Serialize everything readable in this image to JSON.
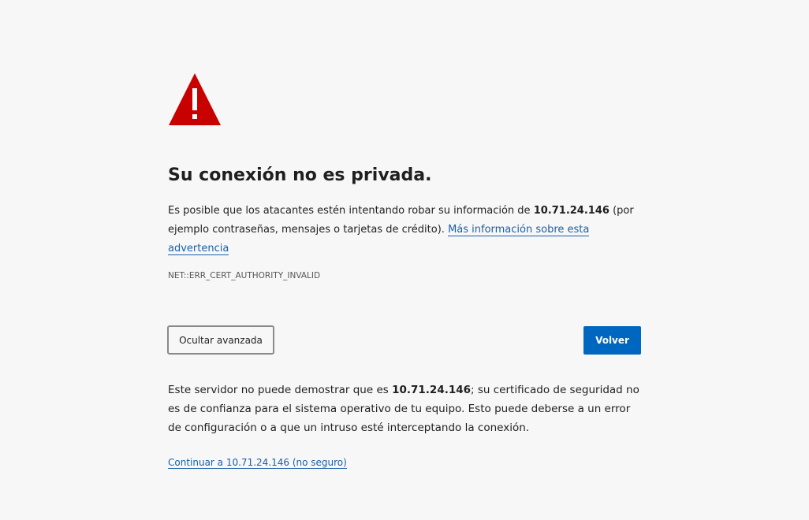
{
  "title": "Su conexión no es privada.",
  "intro": {
    "before_host": "Es posible que los atacantes estén intentando robar su información de ",
    "host": "10.71.24.146",
    "after_host": " (por ejemplo contraseñas, mensajes o tarjetas de crédito). ",
    "learn_more_link": "Más información sobre esta advertencia"
  },
  "error_code": "NET::ERR_CERT_AUTHORITY_INVALID",
  "buttons": {
    "advanced_label": "Ocultar avanzada",
    "back_label": "Volver"
  },
  "details": {
    "before_host": "Este servidor no puede demostrar que es ",
    "host": "10.71.24.146",
    "after_host": "; su certificado de seguridad no es de confianza para el sistema operativo de tu equipo. Esto puede deberse a un error de configuración o a que un intruso esté interceptando la conexión."
  },
  "proceed_link": "Continuar a 10.71.24.146 (no seguro)",
  "colors": {
    "warning_red": "#c80000",
    "primary_blue": "#0067c0",
    "link_blue": "#1a5fa8",
    "background": "#f7f7f7"
  }
}
